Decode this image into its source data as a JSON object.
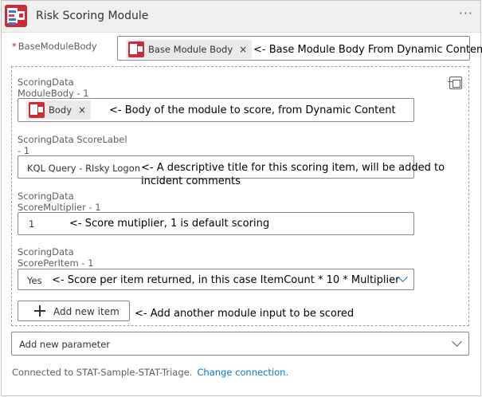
{
  "header": {
    "title": "Risk Scoring Module",
    "more_label": "···"
  },
  "base_module_body": {
    "label": "BaseModuleBody",
    "required_marker": "*",
    "token_label": "Base Module Body",
    "token_remove": "×",
    "note": "<- Base Module Body From Dynamic Content"
  },
  "item": {
    "module_body": {
      "label_line1": "ScoringData",
      "label_line2": "ModuleBody - 1",
      "token_label": "Body",
      "token_remove": "×",
      "note": "<- Body of the module to score, from Dynamic Content"
    },
    "score_label": {
      "label_line1": "ScoringData ScoreLabel",
      "label_line2": "- 1",
      "value": "KQL Query - RIsky Logon",
      "note_line1": "<- A descriptive title for this scoring item, will be added to",
      "note_line2": "incident comments"
    },
    "score_multiplier": {
      "label_line1": "ScoringData",
      "label_line2": "ScoreMultiplier - 1",
      "value": "1",
      "note": "<- Score mutiplier, 1 is default scoring"
    },
    "score_per_item": {
      "label_line1": "ScoringData",
      "label_line2": "ScorePerItem - 1",
      "value": "Yes",
      "note": "<- Score per item returned, in this case ItemCount * 10 * Multiplier"
    }
  },
  "add_item": {
    "label": "Add new item",
    "note": "<- Add another module input to be scored"
  },
  "add_parameter": {
    "placeholder": "Add new parameter"
  },
  "footer": {
    "connected_text": "Connected to STAT-Sample-STAT-Triage.",
    "change_link": "Change connection."
  },
  "colors": {
    "accent": "#0078d4",
    "brand_icon": "#c62f3a",
    "required": "#a4262c"
  }
}
